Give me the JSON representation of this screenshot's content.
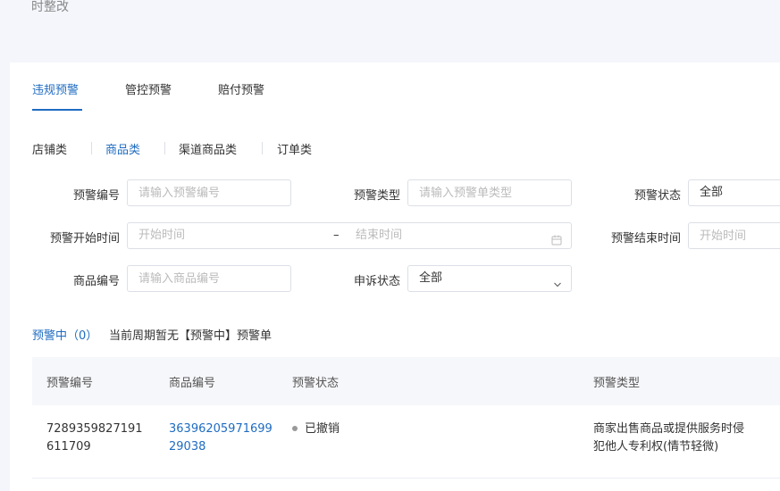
{
  "header": {
    "partial_text": "时整改"
  },
  "tabs": [
    "违规预警",
    "管控预警",
    "赔付预警"
  ],
  "subtabs": [
    "店铺类",
    "商品类",
    "渠道商品类",
    "订单类"
  ],
  "filters": {
    "warning_no": {
      "label": "预警编号",
      "placeholder": "请输入预警编号"
    },
    "warning_type": {
      "label": "预警类型",
      "placeholder": "请输入预警单类型"
    },
    "warning_status": {
      "label": "预警状态",
      "value": "全部"
    },
    "start_time": {
      "label": "预警开始时间",
      "from_placeholder": "开始时间",
      "separator": "–",
      "to_placeholder": "结束时间"
    },
    "end_time": {
      "label": "预警结束时间",
      "placeholder": "开始时间"
    },
    "product_no": {
      "label": "商品编号",
      "placeholder": "请输入商品编号"
    },
    "appeal_status": {
      "label": "申诉状态",
      "value": "全部"
    }
  },
  "summary": {
    "count_label": "预警中（0）",
    "message": "当前周期暂无【预警中】预警单"
  },
  "table": {
    "columns": [
      "预警编号",
      "商品编号",
      "预警状态",
      "预警类型"
    ],
    "rows": [
      {
        "warning_no": [
          "7289359827191",
          "611709"
        ],
        "product_no": [
          "36396205971699",
          "29038"
        ],
        "status": "已撤销",
        "type": [
          "商家出售商品或提供服务时侵",
          "犯他人专利权(情节轻微)"
        ]
      }
    ]
  }
}
